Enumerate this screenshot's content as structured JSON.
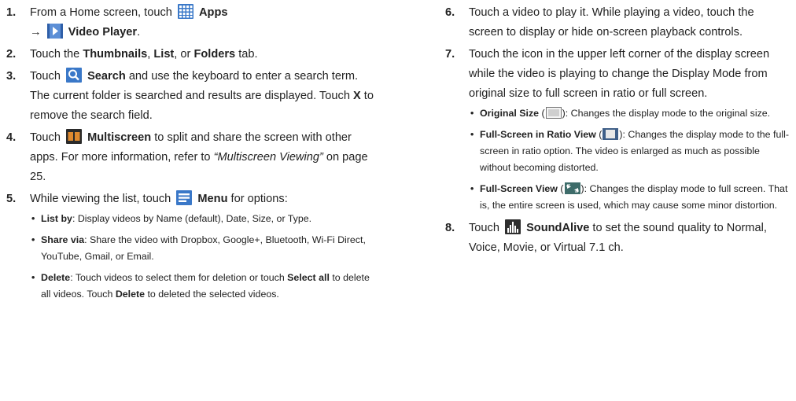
{
  "left": {
    "s1": {
      "num": "1.",
      "t1": "From a Home screen, touch",
      "apps": "Apps",
      "arrow": "→",
      "vp": "Video Player",
      "end": "."
    },
    "s2": {
      "num": "2.",
      "t1": "Touch the ",
      "thumbs": "Thumbnails",
      "c1": ", ",
      "list": "List",
      "c2": ", or ",
      "folders": "Folders",
      "end": " tab."
    },
    "s3": {
      "num": "3.",
      "t1": "Touch",
      "search": "Search",
      "t2": " and use the keyboard to enter a search term. The current folder is searched and results are displayed. Touch ",
      "x": "X",
      "t3": " to remove the search field."
    },
    "s4": {
      "num": "4.",
      "t1": "Touch",
      "multi": "Multiscreen",
      "t2": " to split and share the screen with other apps. For more information, refer to ",
      "ref": "“Multiscreen Viewing”",
      "t3": " on page 25."
    },
    "s5": {
      "num": "5.",
      "t1": "While viewing the list, touch",
      "menu": "Menu",
      "t2": " for options:",
      "b1": {
        "label": "List by",
        "text": ": Display videos by Name (default), Date, Size, or Type."
      },
      "b2": {
        "label": "Share via",
        "text": ": Share the video with Dropbox, Google+, Bluetooth, Wi-Fi Direct, YouTube, Gmail, or Email."
      },
      "b3": {
        "label": "Delete",
        "t1": ": Touch videos to select them for deletion or touch ",
        "selall": "Select all",
        "t2": " to delete all videos. Touch ",
        "del": "Delete",
        "t3": " to deleted the selected videos."
      }
    }
  },
  "right": {
    "s6": {
      "num": "6.",
      "text": "Touch a video to play it. While playing a video, touch the screen to display or hide on-screen playback controls."
    },
    "s7": {
      "num": "7.",
      "text": "Touch the icon in the upper left corner of the display screen while the video is playing to change the Display Mode from original size to full screen in ratio or full screen.",
      "b1": {
        "label": "Original Size",
        "open": " (",
        "close": "): Changes the display mode to the original size."
      },
      "b2": {
        "label": "Full-Screen in Ratio View",
        "open": " (",
        "close": "): Changes the display mode to the full-screen in ratio option. The video is enlarged as much as possible without becoming distorted."
      },
      "b3": {
        "label": "Full-Screen View",
        "open": " (",
        "close": "): Changes the display mode to full screen. That is, the entire screen is used, which may cause some minor distortion."
      }
    },
    "s8": {
      "num": "8.",
      "t1": "Touch",
      "sa": "SoundAlive",
      "t2": " to set the sound quality to Normal, Voice, Movie, or Virtual 7.1 ch."
    }
  },
  "icons": {
    "apps": "apps-grid-icon",
    "video_player": "video-player-icon",
    "search": "search-icon",
    "multiscreen": "multiscreen-icon",
    "menu": "menu-icon",
    "original_size": "original-size-icon",
    "ratio": "full-screen-ratio-icon",
    "full": "full-screen-icon",
    "soundalive": "soundalive-icon",
    "accent": "#3a78c8"
  }
}
